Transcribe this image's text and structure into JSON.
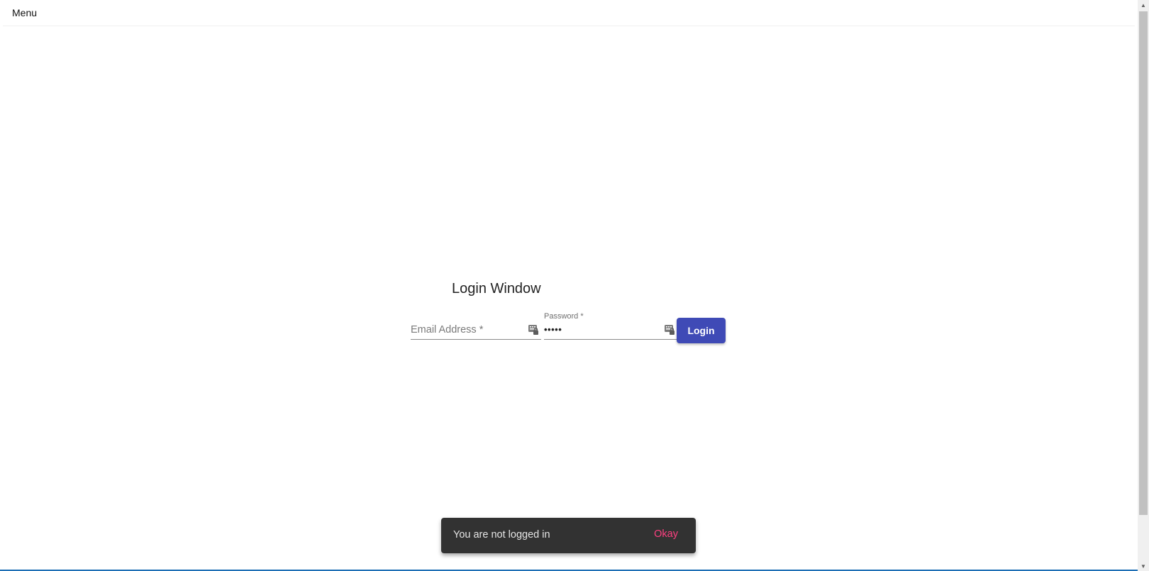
{
  "topbar": {
    "menu_label": "Menu"
  },
  "login": {
    "title": "Login Window",
    "email": {
      "placeholder": "Email Address *",
      "value": ""
    },
    "password": {
      "label": "Password *",
      "value": "•••••"
    },
    "login_button": "Login"
  },
  "snackbar": {
    "message": "You are not logged in",
    "action": "Okay"
  },
  "icons": {
    "field_autofill": "keyboard-lock-icon",
    "scroll_up": "triangle-up-icon",
    "scroll_down": "triangle-down-icon"
  },
  "colors": {
    "primary": "#3f4ab6",
    "snackbar_bg": "#323232",
    "snackbar_action": "#ff4081"
  }
}
